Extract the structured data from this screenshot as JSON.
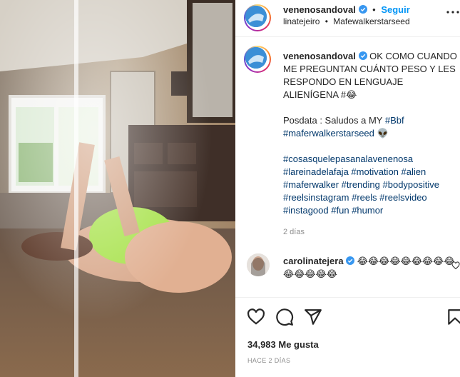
{
  "header": {
    "username": "venenosandoval",
    "follow_label": "Seguir",
    "tagged_user": "linatejeiro",
    "audio": "Mafewalkerstarseed",
    "more_label": "Más opciones"
  },
  "caption": {
    "username": "venenosandoval",
    "line1": "OK COMO CUANDO ME PREGUNTAN CUÁNTO PESO Y LES RESPONDO EN LENGUAJE ALIENÍGENA #😂",
    "ps_text": "Posdata : Saludos a MY ",
    "ps_tag1": "#Bbf",
    "ps_tag2": "#maferwalkerstarseed",
    "ps_emoji": "👽",
    "hashtags": [
      "#cosasquelepasanalavenenosa",
      "#lareinadelafaja",
      "#motivation",
      "#alien",
      "#maferwalker",
      "#trending",
      "#bodypositive",
      "#reelsinstagram",
      "#reels",
      "#reelsvideo",
      "#instagood",
      "#fun",
      "#humor"
    ],
    "time_ago": "2 días"
  },
  "comment": {
    "username": "carolinatejera",
    "text": "😂😂😂😂😂😂😂😂😂😂😂😂😂😂"
  },
  "actions": {
    "likes_count": "34,983",
    "likes_label": "Me gusta",
    "date": "HACE 2 DÍAS"
  },
  "colors": {
    "link": "#00376b",
    "follow": "#0095f6",
    "verified": "#3897f0",
    "meta": "#8e8e8e"
  },
  "icons": [
    "verified-badge-icon",
    "more-icon",
    "heart-icon",
    "comment-icon",
    "share-icon",
    "bookmark-icon"
  ]
}
